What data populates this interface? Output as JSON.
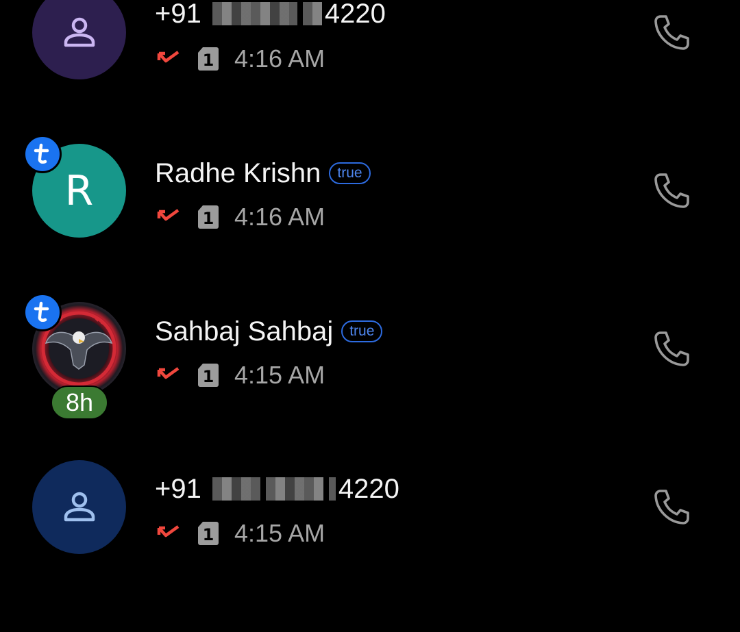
{
  "calls": [
    {
      "number_prefix": "+91",
      "number_suffix": "4220",
      "sim": "1",
      "time": "4:16 AM",
      "avatar_color": "#2d1f4f",
      "icon_color": "#cbb6f2",
      "avatar_icon": "person-icon"
    },
    {
      "name": "Radhe Krishn",
      "tag": "true",
      "letter": "R",
      "sim": "1",
      "time": "4:16 AM",
      "avatar_color": "#17978a",
      "badge": "t"
    },
    {
      "name": "Sahbaj Sahbaj",
      "tag": "true",
      "sim": "1",
      "time": "4:15 AM",
      "badge": "t",
      "duration": "8h",
      "avatar_image": "eagle-emblem"
    },
    {
      "number_prefix": "+91",
      "number_suffix": "4220",
      "sim": "1",
      "time": "4:15 AM",
      "avatar_color": "#0f2a5c",
      "icon_color": "#9fc0ee",
      "avatar_icon": "person-icon"
    }
  ],
  "colors": {
    "missed": "#f0473d",
    "accent_badge": "#1a73f0",
    "call_icon": "#9a9a9a",
    "duration_badge": "#3b7a32"
  }
}
